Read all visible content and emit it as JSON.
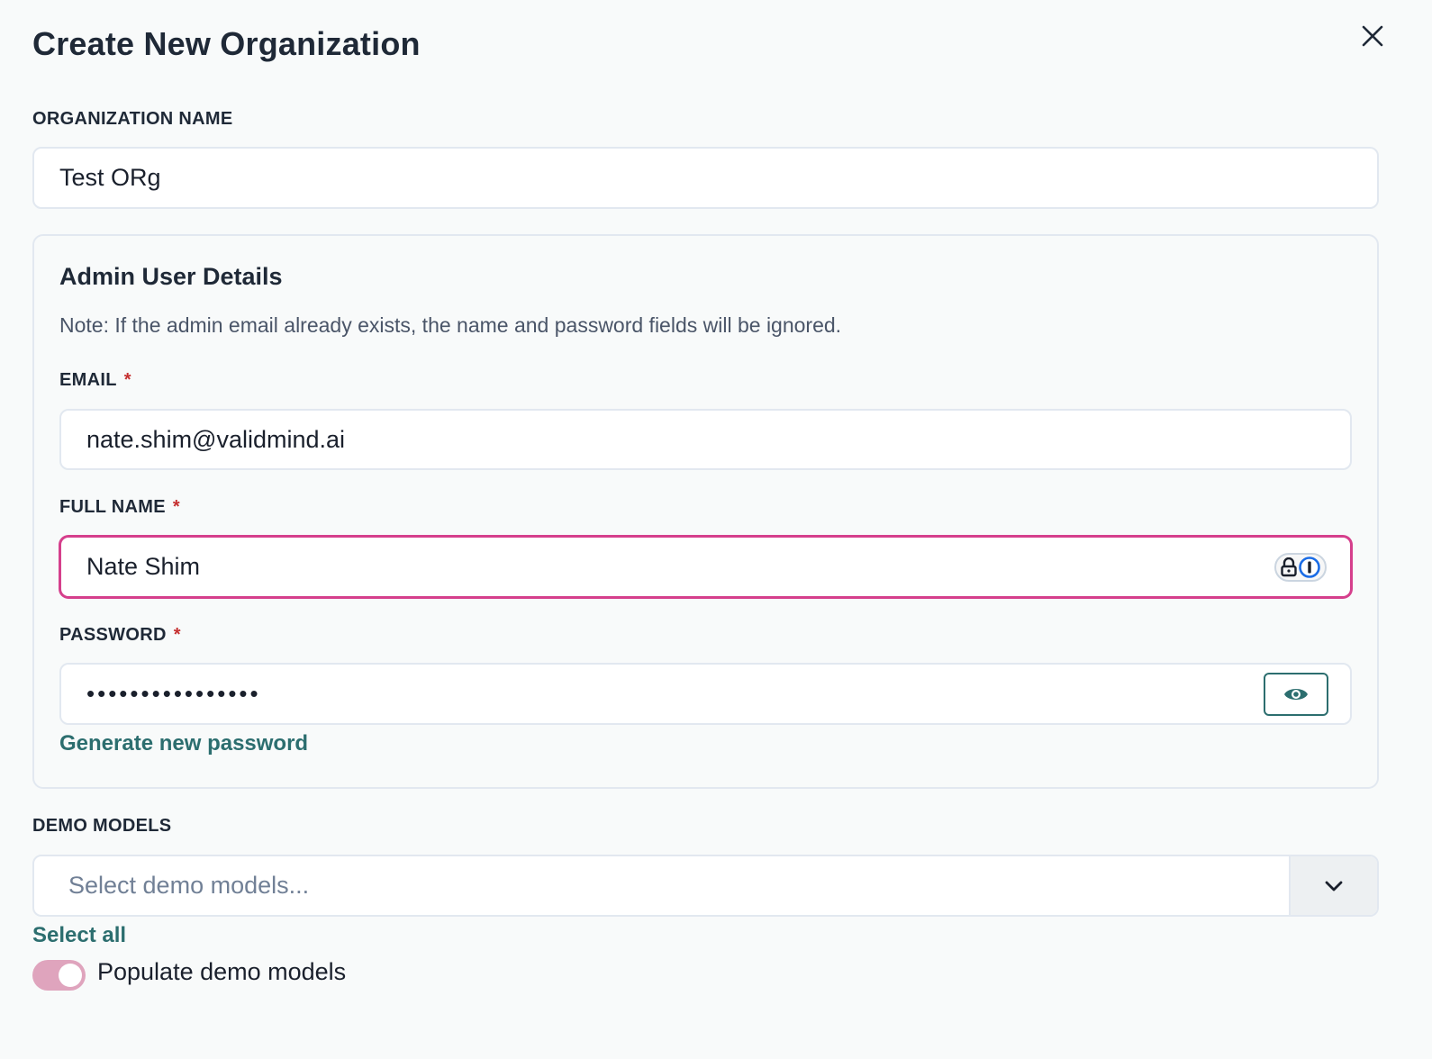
{
  "dialog": {
    "title": "Create New Organization",
    "close_icon": "close-icon"
  },
  "organization": {
    "label": "ORGANIZATION NAME",
    "value": "Test ORg"
  },
  "admin": {
    "title": "Admin User Details",
    "note": "Note: If the admin email already exists, the name and password fields will be ignored.",
    "email": {
      "label": "EMAIL",
      "required_mark": "*",
      "value": "nate.shim@validmind.ai"
    },
    "full_name": {
      "label": "FULL NAME",
      "required_mark": "*",
      "value": "Nate Shim",
      "focus_color": "#d53f8c"
    },
    "password": {
      "label": "PASSWORD",
      "required_mark": "*",
      "masked_value": "••••••••••••••••",
      "toggle_icon": "eye-icon"
    },
    "generate_link": "Generate new password"
  },
  "demo_models": {
    "label": "DEMO MODELS",
    "placeholder": "Select demo models...",
    "select_all": "Select all",
    "populate_label": "Populate demo models",
    "populate_enabled": true
  },
  "colors": {
    "accent": "#2c6e6f",
    "required": "#c53030",
    "toggle_on": "#dfa4bd"
  }
}
